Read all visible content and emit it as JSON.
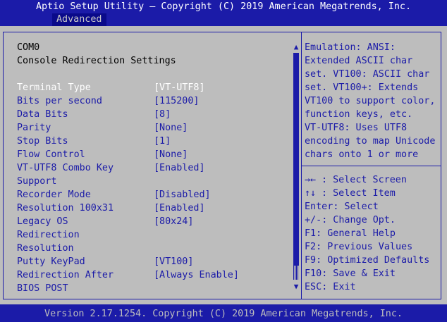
{
  "header": {
    "title": "Aptio Setup Utility – Copyright (C) 2019 American Megatrends, Inc.",
    "tab": "Advanced"
  },
  "left": {
    "port": "COM0",
    "section": "Console Redirection Settings",
    "settings": [
      {
        "label": "Terminal Type",
        "value": "[VT-UTF8]"
      },
      {
        "label": "Bits per second",
        "value": "[115200]"
      },
      {
        "label": "Data Bits",
        "value": "[8]"
      },
      {
        "label": "Parity",
        "value": "[None]"
      },
      {
        "label": "Stop Bits",
        "value": "[1]"
      },
      {
        "label": "Flow Control",
        "value": "[None]"
      },
      {
        "label": "VT-UTF8 Combo Key",
        "label2": "Support",
        "value": "[Enabled]"
      },
      {
        "label": "Recorder Mode",
        "value": "[Disabled]"
      },
      {
        "label": "Resolution 100x31",
        "value": "[Enabled]"
      },
      {
        "label": "Legacy OS",
        "label2": "Redirection",
        "label3": "Resolution",
        "value": "[80x24]"
      },
      {
        "label": "Putty KeyPad",
        "value": "[VT100]"
      },
      {
        "label": "Redirection After",
        "label2": "BIOS POST",
        "value": "[Always Enable]"
      }
    ]
  },
  "scroll": {
    "up_icon": "▲",
    "down_icon": "▼",
    "position_fraction": 1.0
  },
  "help": {
    "lines": [
      "Emulation: ANSI:",
      "Extended ASCII char",
      "set. VT100: ASCII char",
      "set. VT100+: Extends",
      "VT100 to support color,",
      "function keys, etc.",
      "VT-UTF8: Uses UTF8",
      "encoding to map Unicode",
      "chars onto 1 or more"
    ]
  },
  "keys": [
    {
      "key": "→←",
      "desc": ": Select Screen"
    },
    {
      "key": "↑↓",
      "desc": ": Select Item"
    },
    {
      "key": "Enter",
      "desc": ": Select"
    },
    {
      "key": "+/-",
      "desc": ": Change Opt."
    },
    {
      "key": "F1",
      "desc": ": General Help"
    },
    {
      "key": "F2",
      "desc": ": Previous Values"
    },
    {
      "key": "F9",
      "desc": ": Optimized Defaults"
    },
    {
      "key": "F10",
      "desc": ": Save & Exit"
    },
    {
      "key": "ESC",
      "desc": ": Exit"
    }
  ],
  "footer": {
    "version": "Version 2.17.1254. Copyright (C) 2019 American Megatrends, Inc."
  },
  "colors": {
    "background_blue": "#1b1ba8",
    "panel_gray": "#bdbdbd",
    "selected_text": "#ffffff"
  }
}
